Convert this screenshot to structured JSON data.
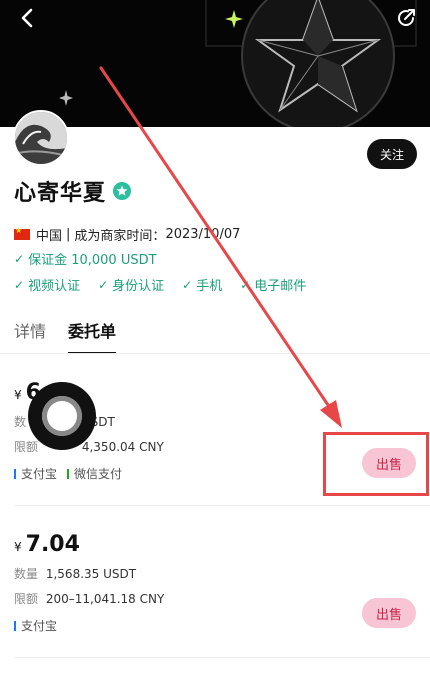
{
  "header": {
    "back_icon": "chevron-left-icon",
    "share_icon": "share-icon"
  },
  "profile": {
    "name": "心寄华夏",
    "follow_label": "关注",
    "country": "中国",
    "merchant_since_label": "成为商家时间",
    "merchant_since": "2023/10/07",
    "deposit": "保证金 10,000 USDT",
    "verifications": [
      "视频认证",
      "身份认证",
      "手机",
      "电子邮件"
    ]
  },
  "tabs": [
    {
      "label": "详情",
      "active": false
    },
    {
      "label": "委托单",
      "active": true
    }
  ],
  "orders": [
    {
      "currency_symbol": "¥",
      "price": "6",
      "quantity_label": "数",
      "quantity": "USDT",
      "limit_label": "限额",
      "limit": "4,350.04 CNY",
      "payments": [
        {
          "label": "支付宝",
          "color": "#1677ff"
        },
        {
          "label": "微信支付",
          "color": "#1aad19"
        }
      ],
      "action_label": "出售"
    },
    {
      "currency_symbol": "¥",
      "price": "7.04",
      "quantity_label": "数量",
      "quantity": "1,568.35 USDT",
      "limit_label": "限额",
      "limit": "200–11,041.18 CNY",
      "payments": [
        {
          "label": "支付宝",
          "color": "#1677ff"
        }
      ],
      "action_label": "出售"
    }
  ],
  "colors": {
    "accent_green": "#1a9f7a",
    "sell_bg": "#f7c5d4",
    "sell_text": "#c6254c",
    "annotation_red": "#e8474a"
  }
}
